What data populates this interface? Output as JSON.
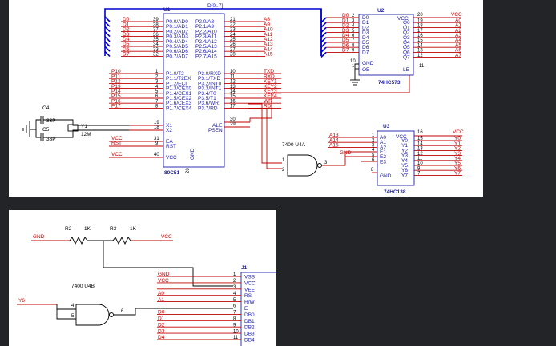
{
  "mcu": {
    "ref": "U1",
    "part": "80C51",
    "bus_label": "D[0..7]",
    "left_nets": [
      "D0",
      "D1",
      "D2",
      "D3",
      "D4",
      "D5",
      "D6",
      "D7"
    ],
    "left_nums": [
      "39",
      "38",
      "37",
      "36",
      "35",
      "34",
      "33",
      "32"
    ],
    "left_pins": [
      "P0.0/AD0",
      "P0.1/AD1",
      "P0.2/AD2",
      "P0.3/AD3",
      "P0.4/AD4",
      "P0.5/AD5",
      "P0.6/AD6",
      "P0.7/AD7"
    ],
    "right_pins": [
      "P2.0/A8",
      "P2.1/A9",
      "P2.2/A10",
      "P2.3/A11",
      "P2.4/A12",
      "P2.5/A13",
      "P2.6/A14",
      "P2.7/A15"
    ],
    "right_nums": [
      "21",
      "22",
      "23",
      "24",
      "25",
      "26",
      "27",
      "28"
    ],
    "right_nets": [
      "A8",
      "A9",
      "A10",
      "A11",
      "A12",
      "A13",
      "A14",
      "A15"
    ],
    "p1_nets": [
      "P10",
      "P11",
      "P12",
      "P13",
      "P14",
      "P15",
      "P16",
      "P17"
    ],
    "p1_nums": [
      "1",
      "2",
      "3",
      "4",
      "5",
      "6",
      "7",
      "8"
    ],
    "p1_pins": [
      "P1.0/T2",
      "P1.1/T2EX",
      "P1.2/ECI",
      "P1.3/CEX0",
      "P1.4/CEX1",
      "P1.5/CEX2",
      "P1.6/CEX3",
      "P1.7/CEX4"
    ],
    "p3_pins": [
      "P3.0/RXD",
      "P3.1/TXD",
      "P3.2/INT0",
      "P3.3/INT1",
      "P3.4/T0",
      "P3.5/T1",
      "P3.6/WR",
      "P3.7/RD"
    ],
    "p3_nums": [
      "10",
      "11",
      "12",
      "13",
      "14",
      "15",
      "16",
      "17"
    ],
    "p3_nets": [
      "TXD",
      "RXD",
      "KEY1",
      "KEY2",
      "KEY3",
      "KEY4",
      "WR",
      "RD"
    ],
    "x1": "X1",
    "x2": "X2",
    "x1_num": "19",
    "x2_num": "18",
    "ea": "EA",
    "rst": "RST",
    "ea_num": "31",
    "rst_num": "9",
    "ale": "ALE",
    "psen": "PSEN",
    "ale_num": "30",
    "psen_num": "29",
    "vcc": "VCC",
    "vcc_num": "40",
    "gnd": "GND",
    "gnd_num": "20",
    "vcc_net": "VCC",
    "rst_net": "RST",
    "vcc_net2": "VCC"
  },
  "crystal": {
    "c4": "C4",
    "c5": "C5",
    "c4_val": "33P",
    "c5_val": "33P",
    "y1": "Y1",
    "y1_val": "12M"
  },
  "latch": {
    "ref": "U2",
    "part": "74HC573",
    "in_nets": [
      "D0",
      "D1",
      "D2",
      "D3",
      "D4",
      "D5",
      "D6",
      "D7"
    ],
    "in_nums": [
      "2",
      "3",
      "4",
      "5",
      "6",
      "7",
      "8",
      "9"
    ],
    "in_pins": [
      "D0",
      "D1",
      "D2",
      "D3",
      "D4",
      "D5",
      "D6",
      "D7"
    ],
    "out_pins": [
      "Q0",
      "Q1",
      "Q2",
      "Q3",
      "Q4",
      "Q5",
      "Q6",
      "Q7"
    ],
    "out_nums": [
      "19",
      "18",
      "17",
      "16",
      "15",
      "14",
      "13",
      "12"
    ],
    "out_nets": [
      "A0",
      "A1",
      "A2",
      "A3",
      "A4",
      "A5",
      "A6",
      "A7"
    ],
    "vcc_pin": "VCC",
    "vcc_num": "20",
    "vcc_net": "VCC",
    "gnd_pin": "GND",
    "gnd_num": "10",
    "oe_pin": "OE",
    "oe_num": "1",
    "le_pin": "LE",
    "le_num": "11"
  },
  "gate_a": {
    "label": "7400  U4A",
    "in1": "1",
    "in2": "2",
    "out": "3"
  },
  "decoder": {
    "ref": "U3",
    "part": "74HC138",
    "in_nets": [
      "A13",
      "A14",
      "A15"
    ],
    "in_nums": [
      "1",
      "2",
      "3"
    ],
    "in_pins": [
      "A0",
      "A1",
      "A2"
    ],
    "e_pins": [
      "E1",
      "E2",
      "E3"
    ],
    "e_nums": [
      "4",
      "5",
      "6"
    ],
    "gnd_net": "GND",
    "gnd_pin": "GND",
    "gnd_num": "8",
    "vcc_pin": "VCC",
    "vcc_num": "16",
    "vcc_net": "VCC",
    "out_pins": [
      "Y0",
      "Y1",
      "Y2",
      "Y3",
      "Y4",
      "Y5",
      "Y6",
      "Y7"
    ],
    "out_nums": [
      "15",
      "14",
      "13",
      "12",
      "11",
      "10",
      "9",
      "7"
    ],
    "out_nets": [
      "Y0",
      "Y1",
      "Y2",
      "Y3",
      "Y4",
      "Y5",
      "Y6",
      "Y7"
    ]
  },
  "lcd_power": {
    "gnd": "GND",
    "vcc": "VCC",
    "r2": "R2",
    "r2_val": "1K",
    "r3": "R3",
    "r3_val": "1K"
  },
  "gate_b": {
    "label": "7400  U4B",
    "in_net": "Y6",
    "in1": "4",
    "in2": "5",
    "out": "6"
  },
  "lcd": {
    "ref": "J1",
    "nets": [
      "GND",
      "VCC",
      "",
      "A0",
      "A1",
      "",
      "D0",
      "D1",
      "D2",
      "D3",
      "D4"
    ],
    "nums": [
      "1",
      "2",
      "3",
      "4",
      "5",
      "6",
      "7",
      "8",
      "9",
      "10",
      "11"
    ],
    "pins": [
      "VSS",
      "VCC",
      "VEE",
      "RS",
      "R/W",
      "E",
      "DB0",
      "DB1",
      "DB2",
      "DB3",
      "DB4"
    ]
  }
}
